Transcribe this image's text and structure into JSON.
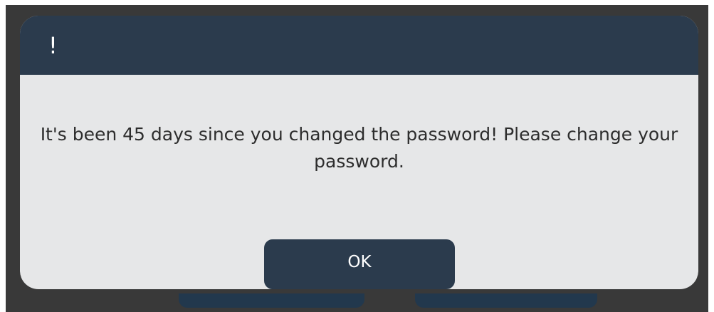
{
  "dialog": {
    "title_glyph": "!",
    "message": "It's been 45 days since you changed the password! Please change your password.",
    "ok_label": "OK"
  },
  "colors": {
    "header": "#2b3b4d",
    "dialog_body": "#e6e7e8",
    "backdrop": "#393939"
  }
}
